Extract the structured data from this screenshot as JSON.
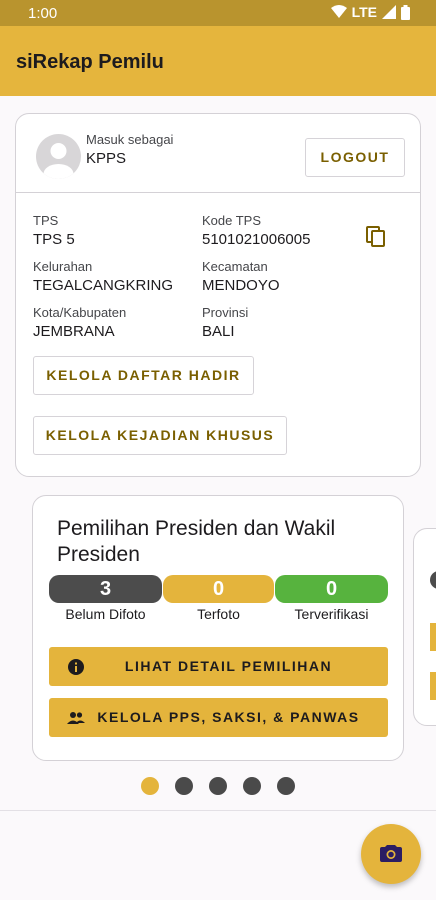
{
  "status_bar": {
    "time": "1:00",
    "network": "LTE"
  },
  "app_bar": {
    "title": "siRekap Pemilu"
  },
  "user_card": {
    "login_label": "Masuk sebagai",
    "role": "KPPS",
    "logout_label": "LOGOUT",
    "fields": {
      "tps": {
        "label": "TPS",
        "value": "TPS 5"
      },
      "kode_tps": {
        "label": "Kode TPS",
        "value": "5101021006005"
      },
      "kelurahan": {
        "label": "Kelurahan",
        "value": "TEGALCANGKRING"
      },
      "kecamatan": {
        "label": "Kecamatan",
        "value": "MENDOYO"
      },
      "kota": {
        "label": "Kota/Kabupaten",
        "value": "JEMBRANA"
      },
      "provinsi": {
        "label": "Provinsi",
        "value": "BALI"
      }
    },
    "buttons": {
      "daftar_hadir": "KELOLA DAFTAR HADIR",
      "kejadian_khusus": "KELOLA KEJADIAN KHUSUS"
    }
  },
  "election_card": {
    "title": "Pemilihan Presiden dan Wakil Presiden",
    "counts": [
      {
        "value": "3",
        "label": "Belum Difoto",
        "color": "#4c4c4c"
      },
      {
        "value": "0",
        "label": "Terfoto",
        "color": "#e4b43c"
      },
      {
        "value": "0",
        "label": "Terverifikasi",
        "color": "#57b33e"
      }
    ],
    "detail_button": "LIHAT DETAIL PEMILIHAN",
    "kelola_button": "KELOLA PPS, SAKSI, & PANWAS"
  },
  "pager": {
    "count": 5,
    "active_index": 0
  },
  "colors": {
    "primary": "#e4b43c",
    "primary_dark": "#b9942e",
    "accent_text": "#7a5f00",
    "success": "#57b33e",
    "neutral": "#4c4c4c"
  },
  "icons": [
    "wifi-icon",
    "signal-icon",
    "battery-icon",
    "avatar-icon",
    "copy-icon",
    "info-icon",
    "people-icon",
    "camera-icon"
  ]
}
